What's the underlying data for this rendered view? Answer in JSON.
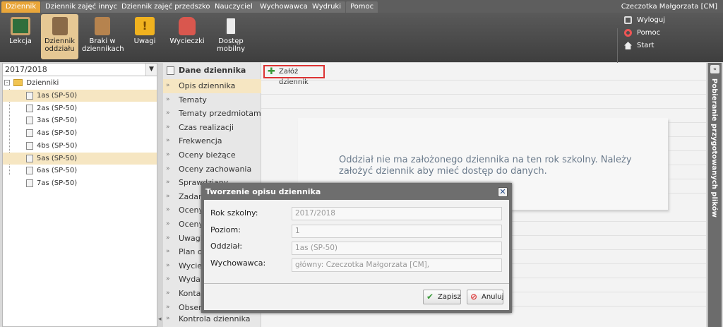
{
  "top_tabs": [
    {
      "label": "Dziennik",
      "active": true
    },
    {
      "label": "Dziennik zajęć innych",
      "active": false
    },
    {
      "label": "Dziennik zajęć przedszkola",
      "active": false
    },
    {
      "label": "Nauczyciel",
      "active": false
    },
    {
      "label": "Wychowawca",
      "active": false
    },
    {
      "label": "Wydruki",
      "active": false
    },
    {
      "label": "Pomoc",
      "active": false
    }
  ],
  "user": {
    "name": "Czeczotka Małgorzata [CM]"
  },
  "ribbon": {
    "buttons": [
      {
        "label": "Lekcja",
        "icon": "chalkboard-icon"
      },
      {
        "label": "Dziennik oddziału",
        "icon": "book-icon",
        "active": true
      },
      {
        "label": "Braki w dziennikach",
        "icon": "missing-entries-icon"
      },
      {
        "label": "Uwagi",
        "icon": "note-alert-icon"
      },
      {
        "label": "Wycieczki",
        "icon": "backpack-icon"
      },
      {
        "label": "Dostęp mobilny",
        "icon": "mobile-phone-icon"
      }
    ],
    "side_links": [
      {
        "label": "Wyloguj",
        "icon": "lock-icon"
      },
      {
        "label": "Pomoc",
        "icon": "lifebuoy-icon"
      },
      {
        "label": "Start",
        "icon": "home-icon"
      }
    ]
  },
  "tree": {
    "year": "2017/2018",
    "root": "Dzienniki",
    "items": [
      {
        "label": "1as (SP-50)",
        "selected": true
      },
      {
        "label": "2as (SP-50)",
        "selected": false
      },
      {
        "label": "3as (SP-50)",
        "selected": false
      },
      {
        "label": "4as (SP-50)",
        "selected": false
      },
      {
        "label": "4bs (SP-50)",
        "selected": false
      },
      {
        "label": "5as (SP-50)",
        "selected": true
      },
      {
        "label": "6as (SP-50)",
        "selected": false
      },
      {
        "label": "7as (SP-50)",
        "selected": false
      }
    ]
  },
  "nav": {
    "header": "Dane dziennika",
    "items": [
      {
        "label": "Opis dziennika",
        "selected": true
      },
      {
        "label": "Tematy"
      },
      {
        "label": "Tematy przedmiotami"
      },
      {
        "label": "Czas realizacji"
      },
      {
        "label": "Frekwencja"
      },
      {
        "label": "Oceny bieżące"
      },
      {
        "label": "Oceny zachowania"
      },
      {
        "label": "Sprawdziany"
      },
      {
        "label": "Zadania"
      },
      {
        "label": "Oceny"
      },
      {
        "label": "Oceny"
      },
      {
        "label": "Uwagi"
      },
      {
        "label": "Plan oddziału"
      },
      {
        "label": "Wycieczki"
      },
      {
        "label": "Wydarzenia"
      },
      {
        "label": "Kontakty"
      },
      {
        "label": "Obserwacje"
      },
      {
        "label": "Kontrola dziennika"
      }
    ]
  },
  "content": {
    "toolbar_button": "Załóż dziennik",
    "message": "Oddział nie ma założonego dziennika na ten rok szkolny. Należy założyć dziennik aby mieć dostęp do danych."
  },
  "right_panel": {
    "label": "Pobieranie przygotowanych plików"
  },
  "modal": {
    "title": "Tworzenie opisu dziennika",
    "fields": [
      {
        "label": "Rok szkolny:",
        "value": "2017/2018"
      },
      {
        "label": "Poziom:",
        "value": "1"
      },
      {
        "label": "Oddział:",
        "value": "1as (SP-50)"
      },
      {
        "label": "Wychowawca:",
        "value": "główny: Czeczotka Małgorzata [CM],"
      }
    ],
    "save_label": "Zapisz",
    "cancel_label": "Anuluj"
  },
  "colors": {
    "accent": "#e9a63a",
    "selection": "#f6e6c2",
    "highlight_border": "#d33"
  }
}
